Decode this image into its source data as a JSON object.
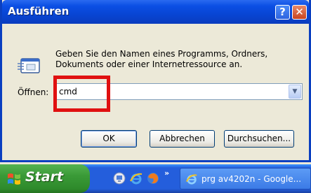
{
  "window": {
    "title": "Ausführen",
    "help_label": "?",
    "close_label": "✕"
  },
  "dialog": {
    "description_line1": "Geben Sie den Namen eines Programms, Ordners,",
    "description_line2": "Dokuments oder einer Internetressource an.",
    "open_label": "Öffnen:",
    "open_value": "cmd"
  },
  "buttons": {
    "ok": "OK",
    "cancel": "Abbrechen",
    "browse": "Durchsuchen..."
  },
  "taskbar": {
    "start_label": "Start",
    "more_label": "»",
    "task_label": "prg av4202n - Google..."
  },
  "icons": {
    "run": "run-dialog-icon",
    "dropdown": "chevron-down-icon",
    "windows_logo": "windows-logo-icon",
    "quick_launch": [
      "desktop-icon",
      "internet-explorer-icon",
      "firefox-icon"
    ],
    "task": "internet-explorer-icon"
  },
  "colors": {
    "titlebar": "#0A4ADF",
    "highlight_box": "#E01010",
    "start_button": "#3A9A37",
    "taskbar": "#245EDC"
  }
}
